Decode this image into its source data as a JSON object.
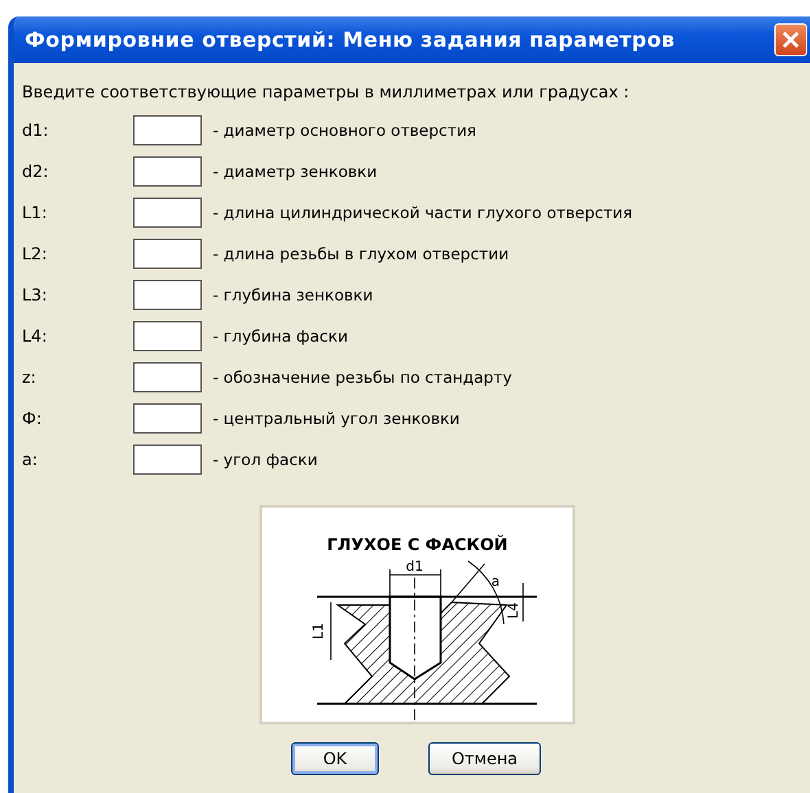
{
  "window": {
    "title": "Формировние отверстий: Меню задания параметров"
  },
  "prompt": "Введите соответствующие параметры в миллиметрах или градусах :",
  "parameters": [
    {
      "label": "d1:",
      "description": "- диаметр основного отверстия"
    },
    {
      "label": "d2:",
      "description": "- диаметр зенковки"
    },
    {
      "label": "L1:",
      "description": "- длина цилиндрической части глухого отверстия"
    },
    {
      "label": "L2:",
      "description": "- длина резьбы в глухом отверстии"
    },
    {
      "label": "L3:",
      "description": "- глубина зенковки"
    },
    {
      "label": "L4:",
      "description": "- глубина фаски"
    },
    {
      "label": "z:",
      "description": "- обозначение резьбы по стандарту"
    },
    {
      "label": "Ф:",
      "description": "- центральный угол зенковки"
    },
    {
      "label": "a:",
      "description": "- угол фаски"
    }
  ],
  "diagram": {
    "title": "ГЛУХОЕ С ФАСКОЙ",
    "labels": [
      {
        "kind": "d1",
        "text": "d1"
      },
      {
        "kind": "l1",
        "text": "L1"
      },
      {
        "kind": "l4",
        "text": "L4"
      },
      {
        "kind": "angle",
        "text": "a"
      }
    ]
  },
  "buttons": [
    "OK",
    "Отмена"
  ]
}
